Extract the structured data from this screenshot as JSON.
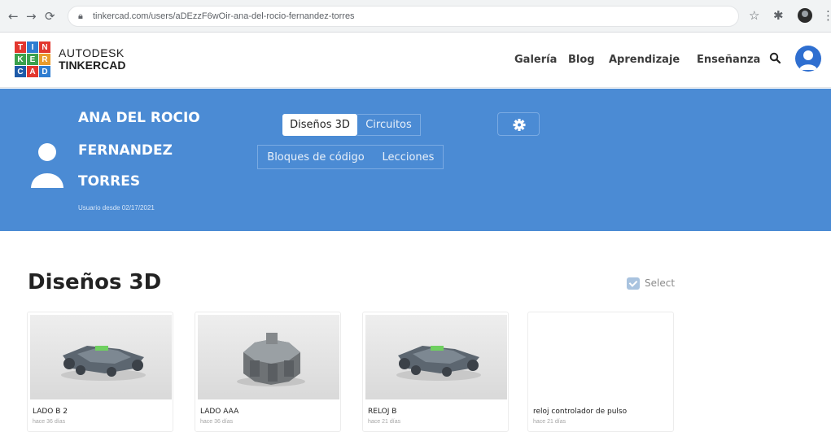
{
  "browser": {
    "url": "tinkercad.com/users/aDEzzF6wOir-ana-del-rocio-fernandez-torres"
  },
  "logo": {
    "letters": [
      "T",
      "I",
      "N",
      "K",
      "E",
      "R",
      "C",
      "A",
      "D"
    ],
    "colors": [
      "#e2372f",
      "#2e7dd1",
      "#e2372f",
      "#3aa14d",
      "#3aa14d",
      "#e89b2c",
      "#1e5aa8",
      "#e2372f",
      "#2e7dd1"
    ],
    "brand_top": "AUTODESK",
    "brand_bottom": "TINKERCAD"
  },
  "nav": {
    "items": [
      "Galería",
      "Blog",
      "Aprendizaje",
      "Enseñanza"
    ]
  },
  "profile": {
    "name_lines": [
      "ANA DEL ROCIO",
      "FERNANDEZ",
      "TORRES"
    ],
    "member_since": "Usuario desde 02/17/2021"
  },
  "tabs": {
    "row1": [
      "Diseños 3D",
      "Circuitos"
    ],
    "row2": [
      "Bloques de código",
      "Lecciones"
    ],
    "active": "Diseños 3D"
  },
  "section": {
    "title": "Diseños 3D",
    "select_label": "Select"
  },
  "designs": [
    {
      "title": "LADO B 2",
      "subtitle": "hace 36 días",
      "thumbnail": "robot-car-model"
    },
    {
      "title": "LADO AAA",
      "subtitle": "hace 36 días",
      "thumbnail": "gear-block-model"
    },
    {
      "title": "RELOJ B",
      "subtitle": "hace 21 días",
      "thumbnail": "robot-car-model"
    },
    {
      "title": "reloj controlador de pulso",
      "subtitle": "hace 21 días",
      "thumbnail": "blank"
    }
  ],
  "colors": {
    "banner": "#4b8bd4",
    "accent": "#2f6fd0"
  }
}
